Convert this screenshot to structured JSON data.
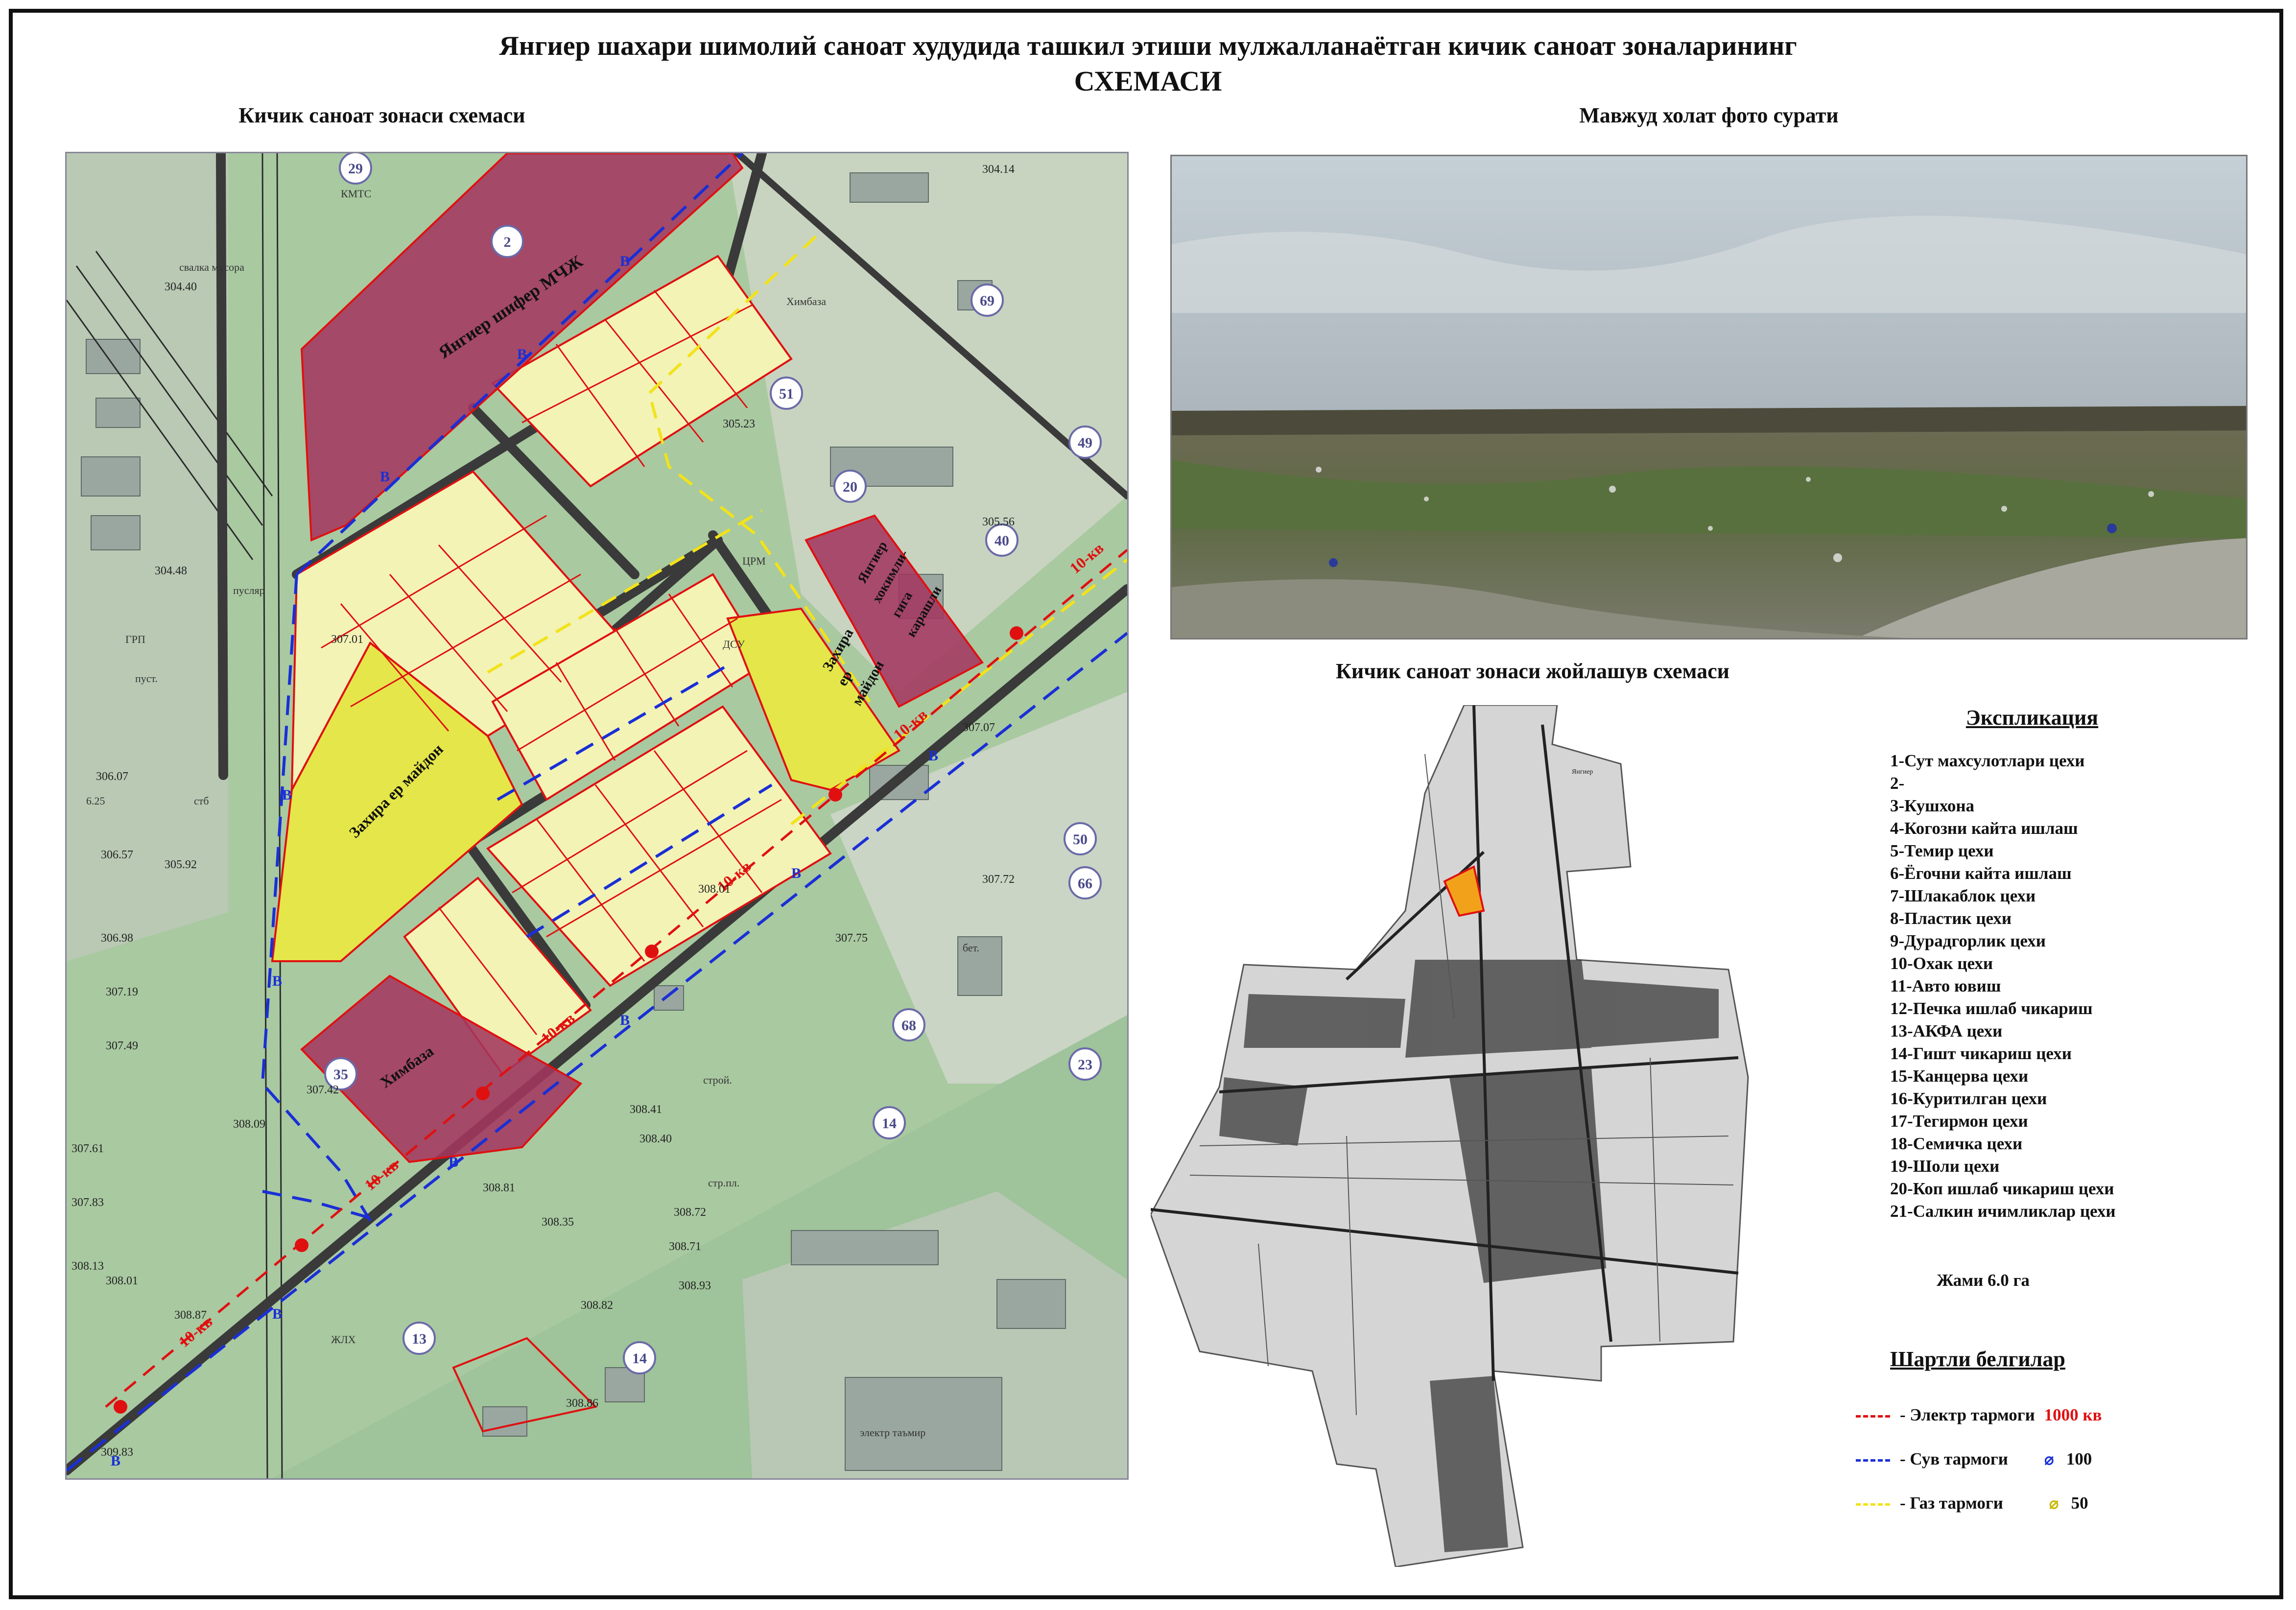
{
  "title": {
    "line1": "Янгиер шахари шимолий саноат худудида ташкил этиши мулжалланаётган кичик саноат зоналарининг",
    "line2": "СХЕМАСИ"
  },
  "captions": {
    "left_map": "Кичик саноат зонаси схемаси",
    "photo": "Мавжуд холат фото сурати",
    "location_map": "Кичик саноат зонаси жойлашув схемаси"
  },
  "map_labels": {
    "zone_shifer": "Янгиер шифер МЧЖ",
    "zone_reserve_left": "Захира ер майдон",
    "zone_reserve_right_1": "Захира",
    "zone_reserve_right_2": "ер",
    "zone_reserve_right_3": "майдон",
    "zone_khokim_1": "Янгиер",
    "zone_khokim_2": "хокимли-",
    "zone_khokim_3": "гига",
    "zone_khokim_4": "карашли",
    "zone_khimbaza": "Химбаза",
    "line_voltage": "10-кв",
    "water_mark": "В",
    "district_numbers": [
      "29",
      "2",
      "69",
      "51",
      "49",
      "20",
      "40",
      "50",
      "66",
      "68",
      "23",
      "14",
      "13",
      "14",
      "35"
    ],
    "elevations": [
      "304.40",
      "304.48",
      "306.07",
      "306.57",
      "306.98",
      "307.19",
      "307.49",
      "307.61",
      "307.83",
      "308.13",
      "308.01",
      "308.87",
      "309.83",
      "305.92",
      "307.01",
      "307.07",
      "307.72",
      "307.75",
      "307.42",
      "308.40",
      "308.81",
      "308.35",
      "308.72",
      "308.71",
      "308.93",
      "308.82",
      "308.86",
      "308.41",
      "308.09",
      "304.14",
      "305.23",
      "305.56",
      "308.01"
    ],
    "small_labels": [
      "КМТС",
      "свалка мусора",
      "пусляр",
      "ГРП",
      "пуст.",
      "стб",
      "6.25",
      "ЦРМ",
      "ДСУ",
      "Химбаза",
      "бет.",
      "ЖЛХ",
      "строй.",
      "стр.пл.",
      "электр таъмир"
    ]
  },
  "explication": {
    "title": "Экспликация",
    "items": [
      "1-Сут махсулотлари цехи",
      "2-",
      "3-Кушхона",
      "4-Когозни кайта ишлаш",
      "5-Темир цехи",
      "6-Ёгочни кайта ишлаш",
      "7-Шлакаблок цехи",
      "8-Пластик цехи",
      "9-Дурадгорлик цехи",
      "10-Охак цехи",
      "11-Авто ювиш",
      "12-Печка ишлаб чикариш",
      "13-АКФА цехи",
      "14-Гишт чикариш цехи",
      "15-Канцерва цехи",
      "16-Куритилган цехи",
      "17-Тегирмон цехи",
      "18-Семичка цехи",
      "19-Шоли цехи",
      "20-Коп ишлаб чикариш цехи",
      "21-Салкин ичимликлар цехи"
    ],
    "total": "Жами  6.0 га"
  },
  "legend": {
    "title": "Шартли белгилар",
    "electric": {
      "label": "- Электр тармоги",
      "value": "1000 кв",
      "color": "#e01010"
    },
    "water": {
      "label": "- Сув тармоги",
      "symbol": "⌀",
      "value": "100",
      "color": "#1a2fd6"
    },
    "gas": {
      "label": "- Газ тармоги",
      "symbol": "⌀",
      "value": "50",
      "color": "#f2e21a"
    }
  },
  "location_map": {
    "town_label": "Янгиер"
  },
  "colors": {
    "zone_pink": "#a3375f",
    "zone_light_yellow": "#f3f3b6",
    "zone_yellow": "#e4e649",
    "road": "#3a3a3a",
    "map_green": "#a9c9a1",
    "boundary_red": "#e01010"
  }
}
